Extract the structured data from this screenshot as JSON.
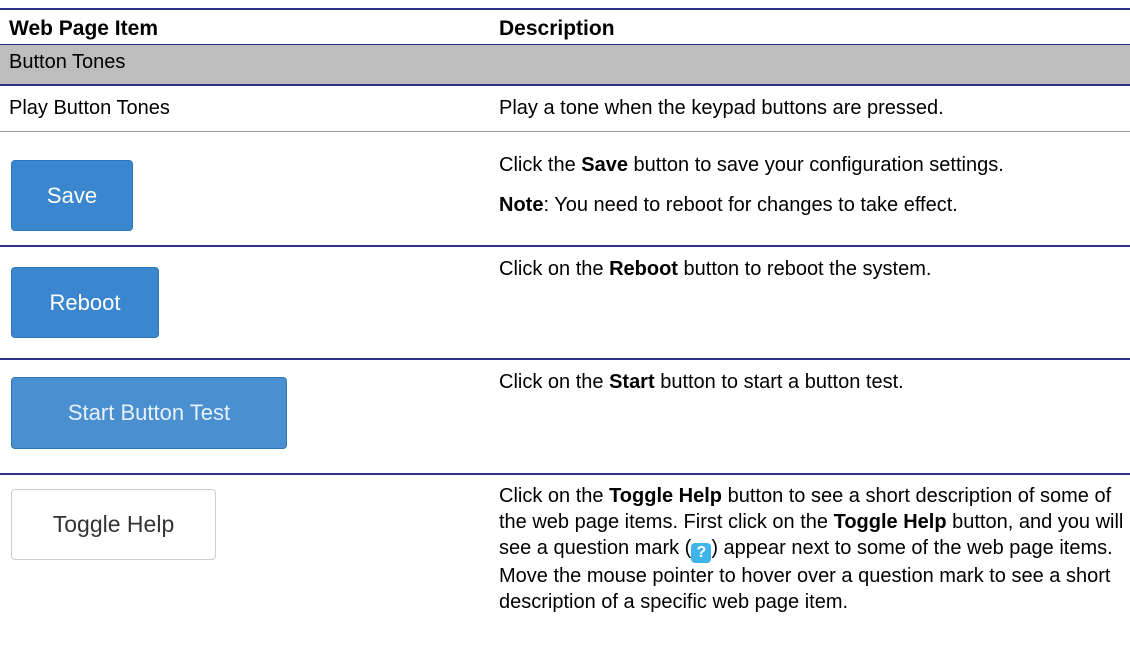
{
  "header": {
    "col1": "Web Page Item",
    "col2": "Description"
  },
  "section": "Button Tones",
  "rows": [
    {
      "item": "Play Button Tones",
      "desc": "Play a tone when the keypad buttons are pressed."
    }
  ],
  "save": {
    "button": "Save",
    "d1_pre": "Click the ",
    "d1_bold": "Save",
    "d1_post": " button to save your configuration settings.",
    "note_bold": "Note",
    "note_text": ": You need to reboot for changes to take effect."
  },
  "reboot": {
    "button": "Reboot",
    "d_pre": "Click on the ",
    "d_bold": "Reboot",
    "d_post": " button to reboot the system."
  },
  "start": {
    "button": "Start Button Test",
    "d_pre": "Click on the ",
    "d_bold": "Start",
    "d_post": " button to start a button test."
  },
  "toggle": {
    "button": "Toggle Help",
    "p1": "Click on the ",
    "b1": "Toggle Help",
    "p2": " button to see a short description of some of the web page items. First click on the ",
    "b2": "Toggle Help",
    "p3": " button, and you will see a question mark (",
    "icon": "?",
    "p4": ") appear next to some of the web page items. Move the mouse pointer to hover over a question mark to see a short description of a specific web page item."
  }
}
